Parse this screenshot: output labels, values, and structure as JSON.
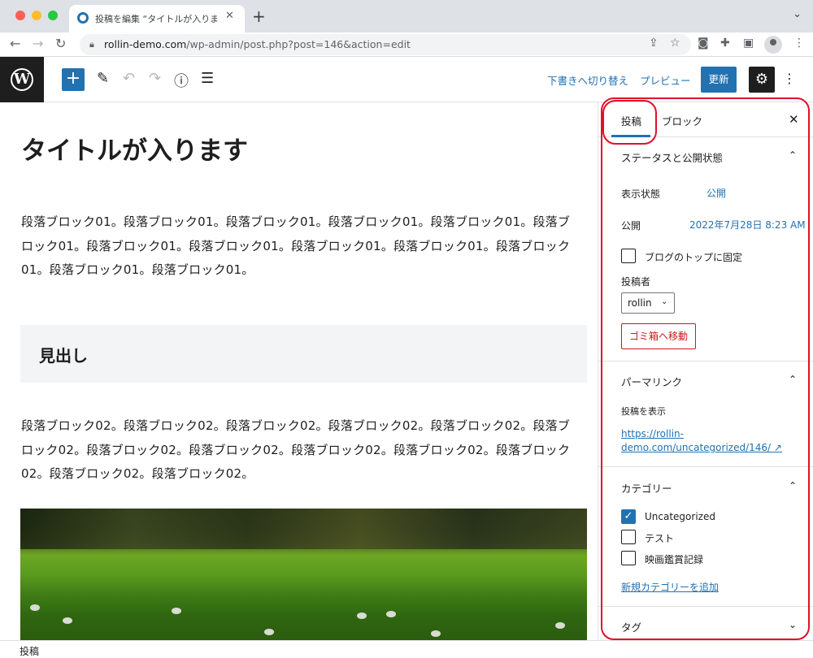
{
  "browser": {
    "tab_title": "投稿を編集 “タイトルが入ります”",
    "tab_close": "✕",
    "new_tab": "+",
    "url_host": "rollin-demo.com",
    "url_path": "/wp-admin/post.php?post=146&action=edit"
  },
  "header": {
    "add_label": "+",
    "switch_draft": "下書きへ切り替え",
    "preview": "プレビュー",
    "update": "更新"
  },
  "post": {
    "title": "タイトルが入ります",
    "paragraph1": "段落ブロック01。段落ブロック01。段落ブロック01。段落ブロック01。段落ブロック01。段落ブロック01。段落ブロック01。段落ブロック01。段落ブロック01。段落ブロック01。段落ブロック01。段落ブロック01。段落ブロック01。",
    "heading": "見出し",
    "paragraph2": "段落ブロック02。段落ブロック02。段落ブロック02。段落ブロック02。段落ブロック02。段落ブロック02。段落ブロック02。段落ブロック02。段落ブロック02。段落ブロック02。段落ブロック02。段落ブロック02。段落ブロック02。"
  },
  "sidebar": {
    "tab_post": "投稿",
    "tab_block": "ブロック",
    "close": "✕",
    "status": {
      "title": "ステータスと公開状態",
      "visibility_label": "表示状態",
      "visibility_value": "公開",
      "publish_label": "公開",
      "publish_value": "2022年7月28日 8:23 AM",
      "sticky_label": "ブログのトップに固定",
      "author_label": "投稿者",
      "author_value": "rollin",
      "trash": "ゴミ箱へ移動"
    },
    "permalink": {
      "title": "パーマリンク",
      "view_label": "投稿を表示",
      "url": "https://rollin-demo.com/uncategorized/146/"
    },
    "categories": {
      "title": "カテゴリー",
      "items": [
        {
          "label": "Uncategorized",
          "checked": true
        },
        {
          "label": "テスト",
          "checked": false
        },
        {
          "label": "映画鑑賞記録",
          "checked": false
        }
      ],
      "add_new": "新規カテゴリーを追加"
    },
    "tags": {
      "title": "タグ"
    }
  },
  "footer": {
    "breadcrumb": "投稿"
  },
  "colors": {
    "accent": "#2271b1",
    "highlight": "#e0102a",
    "danger": "#cc1818"
  }
}
